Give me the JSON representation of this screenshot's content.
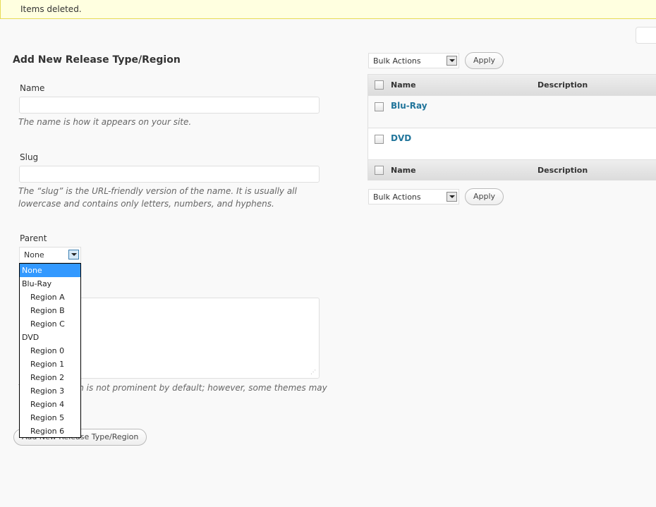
{
  "notice": "Items deleted.",
  "form": {
    "title": "Add New Release Type/Region",
    "name_label": "Name",
    "name_value": "",
    "name_hint": "The name is how it appears on your site.",
    "slug_label": "Slug",
    "slug_value": "",
    "slug_hint": "The “slug” is the URL-friendly version of the name. It is usually all lowercase and contains only letters, numbers, and hyphens.",
    "parent_label": "Parent",
    "parent_value": "None",
    "description_hint": "The description is not prominent by default; however, some themes may",
    "submit_label": "Add New Release Type/Region"
  },
  "parent_options": [
    {
      "label": "None",
      "indent": false,
      "selected": true
    },
    {
      "label": "Blu-Ray",
      "indent": false
    },
    {
      "label": "Region A",
      "indent": true
    },
    {
      "label": "Region B",
      "indent": true
    },
    {
      "label": "Region C",
      "indent": true
    },
    {
      "label": "DVD",
      "indent": false
    },
    {
      "label": "Region 0",
      "indent": true
    },
    {
      "label": "Region 1",
      "indent": true
    },
    {
      "label": "Region 2",
      "indent": true
    },
    {
      "label": "Region 3",
      "indent": true
    },
    {
      "label": "Region 4",
      "indent": true
    },
    {
      "label": "Region 5",
      "indent": true
    },
    {
      "label": "Region 6",
      "indent": true
    }
  ],
  "list": {
    "bulk_actions": "Bulk Actions",
    "apply": "Apply",
    "columns": [
      "Name",
      "Description"
    ],
    "rows": [
      {
        "name": "Blu-Ray",
        "description": ""
      },
      {
        "name": "DVD",
        "description": ""
      }
    ]
  },
  "colors": {
    "link": "#21759b",
    "selected_option": "#3399ff",
    "notice_bg": "#ffffe0"
  }
}
